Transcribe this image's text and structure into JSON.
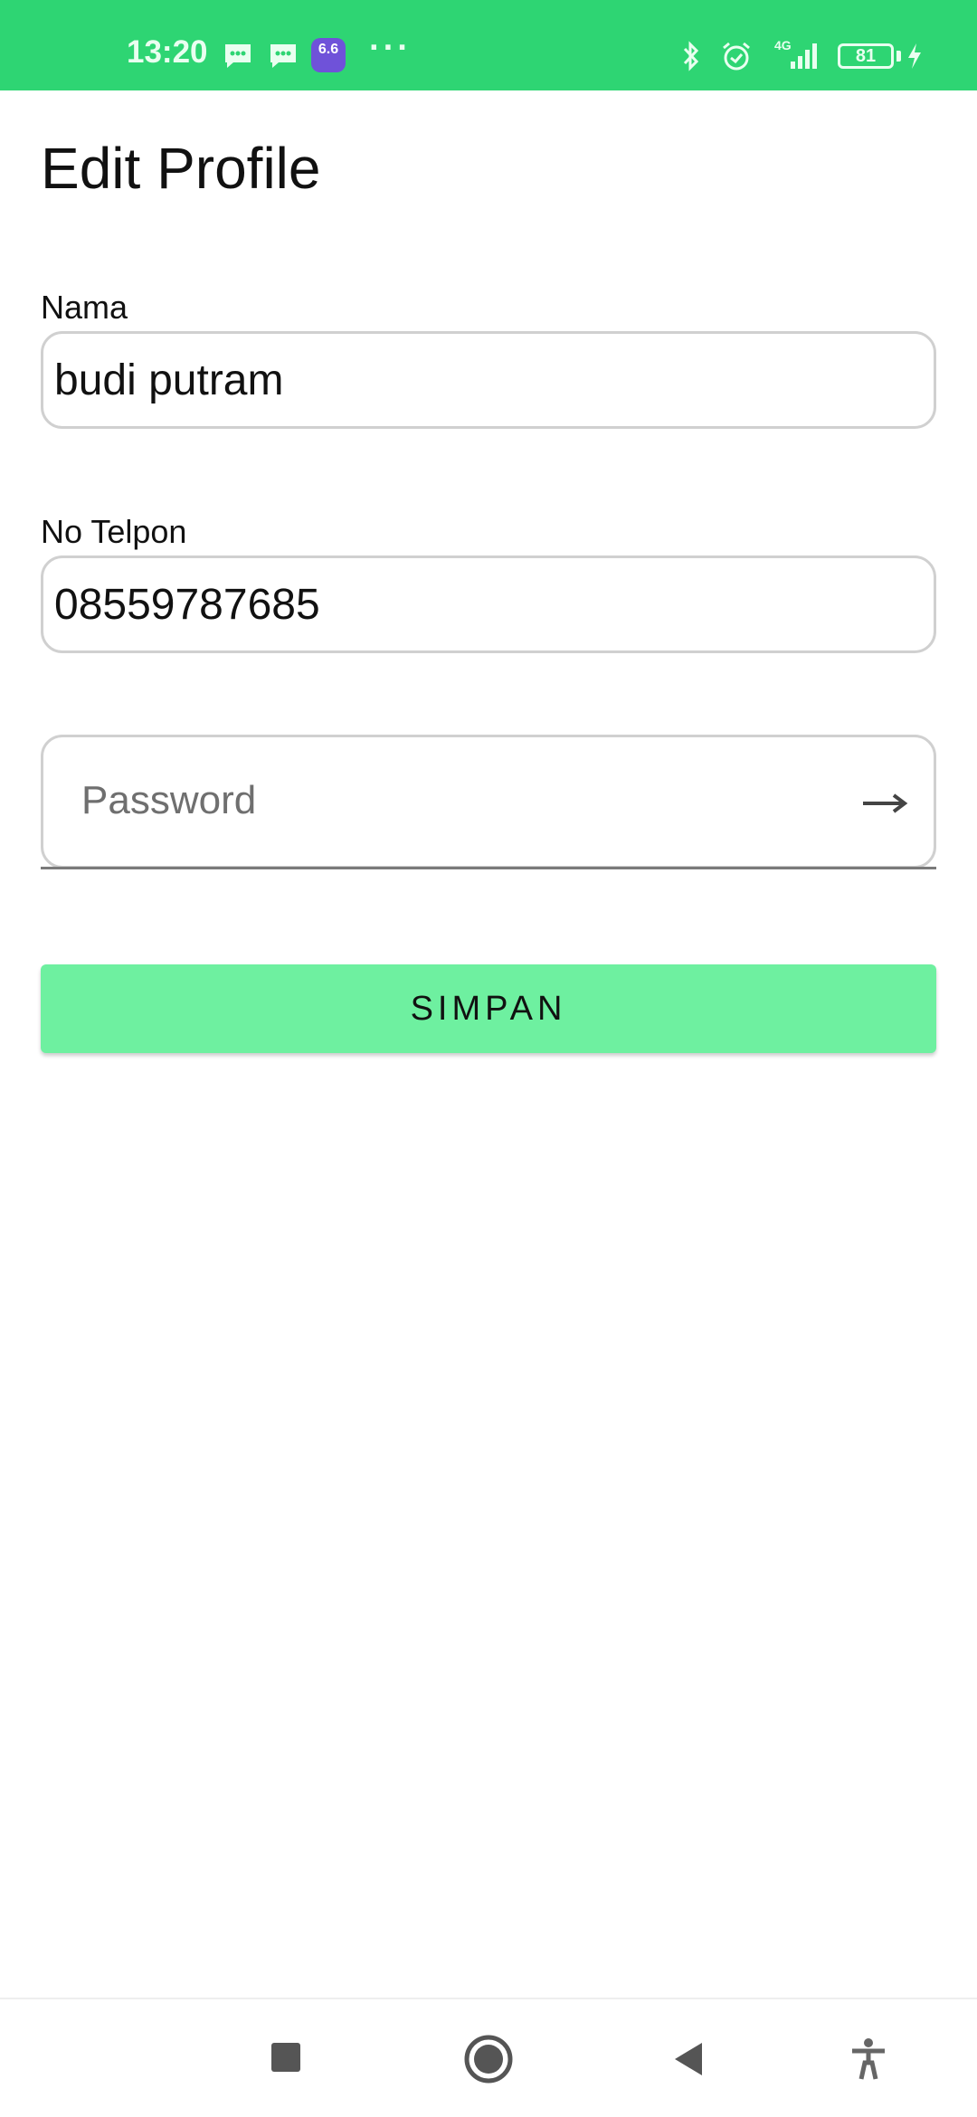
{
  "status_bar": {
    "time": "13:20",
    "badge_text": "6.6",
    "more_indicator": "···",
    "network": "4G",
    "battery_level": "81",
    "background_color": "#2ed573",
    "icons": [
      "message-icon",
      "message-icon",
      "app-badge-icon",
      "bluetooth-icon",
      "alarm-icon",
      "signal-icon",
      "battery-icon",
      "charging-icon"
    ]
  },
  "page": {
    "title": "Edit Profile"
  },
  "form": {
    "name_label": "Nama",
    "name_value": "budi putram",
    "phone_label": "No Telpon",
    "phone_value": "08559787685",
    "password_placeholder": "Password",
    "password_toggle_icon": "arrow-right-icon",
    "save_label": "SIMPAN",
    "save_color": "#6ef0a0"
  },
  "nav_bar": {
    "buttons": [
      "recents-icon",
      "home-icon",
      "back-icon",
      "accessibility-icon"
    ]
  }
}
